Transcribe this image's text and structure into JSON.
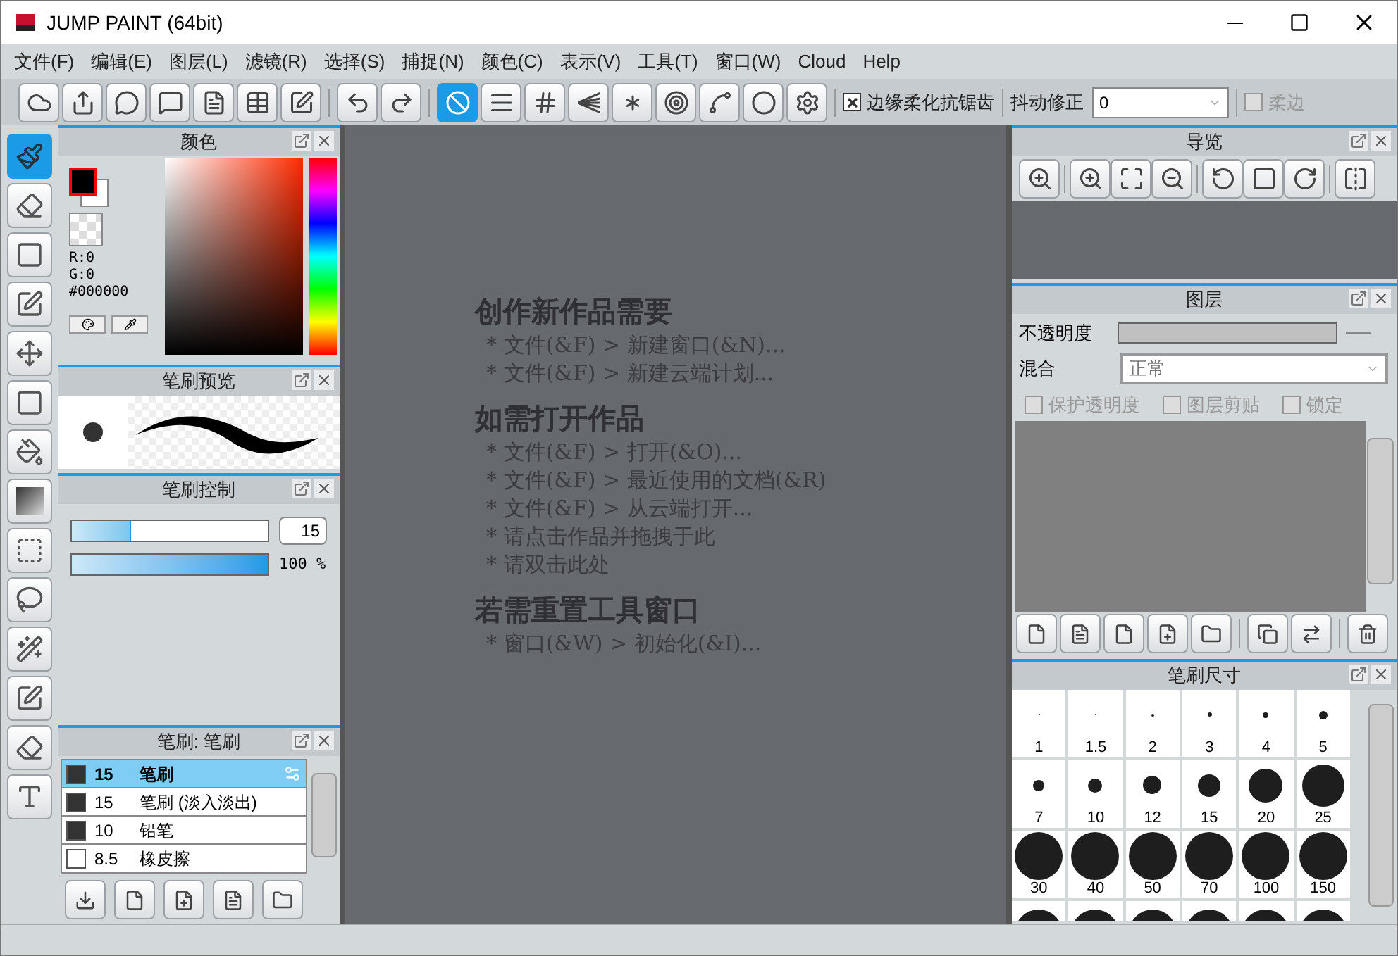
{
  "window": {
    "title": "JUMP PAINT (64bit)"
  },
  "menu": [
    "文件(F)",
    "编辑(E)",
    "图层(L)",
    "滤镜(R)",
    "选择(S)",
    "捕捉(N)",
    "颜色(C)",
    "表示(V)",
    "工具(T)",
    "窗口(W)",
    "Cloud",
    "Help"
  ],
  "toolbar": {
    "ruler_buttons": [
      {
        "kind": "none",
        "selected": true
      },
      {
        "kind": "parallel",
        "selected": false
      },
      {
        "kind": "grid",
        "selected": false
      },
      {
        "kind": "perspective",
        "selected": false
      },
      {
        "kind": "radial",
        "selected": false
      },
      {
        "kind": "concentric",
        "selected": false
      },
      {
        "kind": "curve",
        "selected": false
      },
      {
        "kind": "ellipse",
        "selected": false
      },
      {
        "kind": "settings",
        "selected": false
      }
    ],
    "antialias": {
      "label": "边缘柔化抗锯齿",
      "checked": true
    },
    "stabilizer": {
      "label": "抖动修正",
      "value": "0"
    },
    "soft_edge": {
      "label": "柔边",
      "checked": false
    }
  },
  "tools": [
    {
      "kind": "brush",
      "selected": true
    },
    {
      "kind": "eraser",
      "selected": false
    },
    {
      "kind": "rect",
      "selected": false
    },
    {
      "kind": "dots",
      "selected": false
    },
    {
      "kind": "move",
      "selected": false
    },
    {
      "kind": "fill-rect",
      "selected": false
    },
    {
      "kind": "bucket",
      "selected": false
    },
    {
      "kind": "gradient",
      "selected": false
    },
    {
      "kind": "select",
      "selected": false
    },
    {
      "kind": "lasso",
      "selected": false
    },
    {
      "kind": "wand",
      "selected": false
    },
    {
      "kind": "select-pen",
      "selected": false
    },
    {
      "kind": "select-eraser",
      "selected": false
    },
    {
      "kind": "text",
      "selected": false
    }
  ],
  "color_panel": {
    "title": "颜色",
    "r": "R:0",
    "g": "G:0",
    "hex": "#000000"
  },
  "brush_preview": {
    "title": "笔刷预览"
  },
  "brush_control": {
    "title": "笔刷控制",
    "size": {
      "level": 0.3,
      "value": "15"
    },
    "opacity": {
      "level": 1,
      "value": "100 %"
    }
  },
  "brush_list": {
    "title": "笔刷: 笔刷",
    "items": [
      {
        "size": "15",
        "name": "笔刷",
        "selected": true,
        "color": "#333333"
      },
      {
        "size": "15",
        "name": "笔刷 (淡入淡出)",
        "selected": false,
        "color": "#333333"
      },
      {
        "size": "10",
        "name": "铅笔",
        "selected": false,
        "color": "#333333"
      },
      {
        "size": "8.5",
        "name": "橡皮擦",
        "selected": false,
        "color": "#ffffff"
      }
    ]
  },
  "canvas": {
    "sections": [
      {
        "heading": "创作新作品需要",
        "items": [
          "* 文件(&F) > 新建窗口(&N)...",
          "* 文件(&F) > 新建云端计划..."
        ]
      },
      {
        "heading": "如需打开作品",
        "items": [
          "* 文件(&F) > 打开(&O)...",
          "* 文件(&F) > 最近使用的文档(&R)",
          "* 文件(&F) > 从云端打开...",
          "* 请点击作品并拖拽于此",
          "* 请双击此处"
        ]
      },
      {
        "heading": "若需重置工具窗口",
        "items": [
          "* 窗口(&W) > 初始化(&I)..."
        ]
      }
    ]
  },
  "navigator": {
    "title": "导览"
  },
  "layers": {
    "title": "图层",
    "opacity_label": "不透明度",
    "blend_label": "混合",
    "blend_value": "正常",
    "options": [
      {
        "label": "保护透明度",
        "checked": false
      },
      {
        "label": "图层剪贴",
        "checked": false
      },
      {
        "label": "锁定",
        "checked": false
      }
    ]
  },
  "brush_size": {
    "title": "笔刷尺寸",
    "sizes": [
      "1",
      "1.5",
      "2",
      "3",
      "4",
      "5",
      "7",
      "10",
      "12",
      "15",
      "20",
      "25",
      "30",
      "40",
      "50",
      "70",
      "100",
      "150"
    ]
  }
}
